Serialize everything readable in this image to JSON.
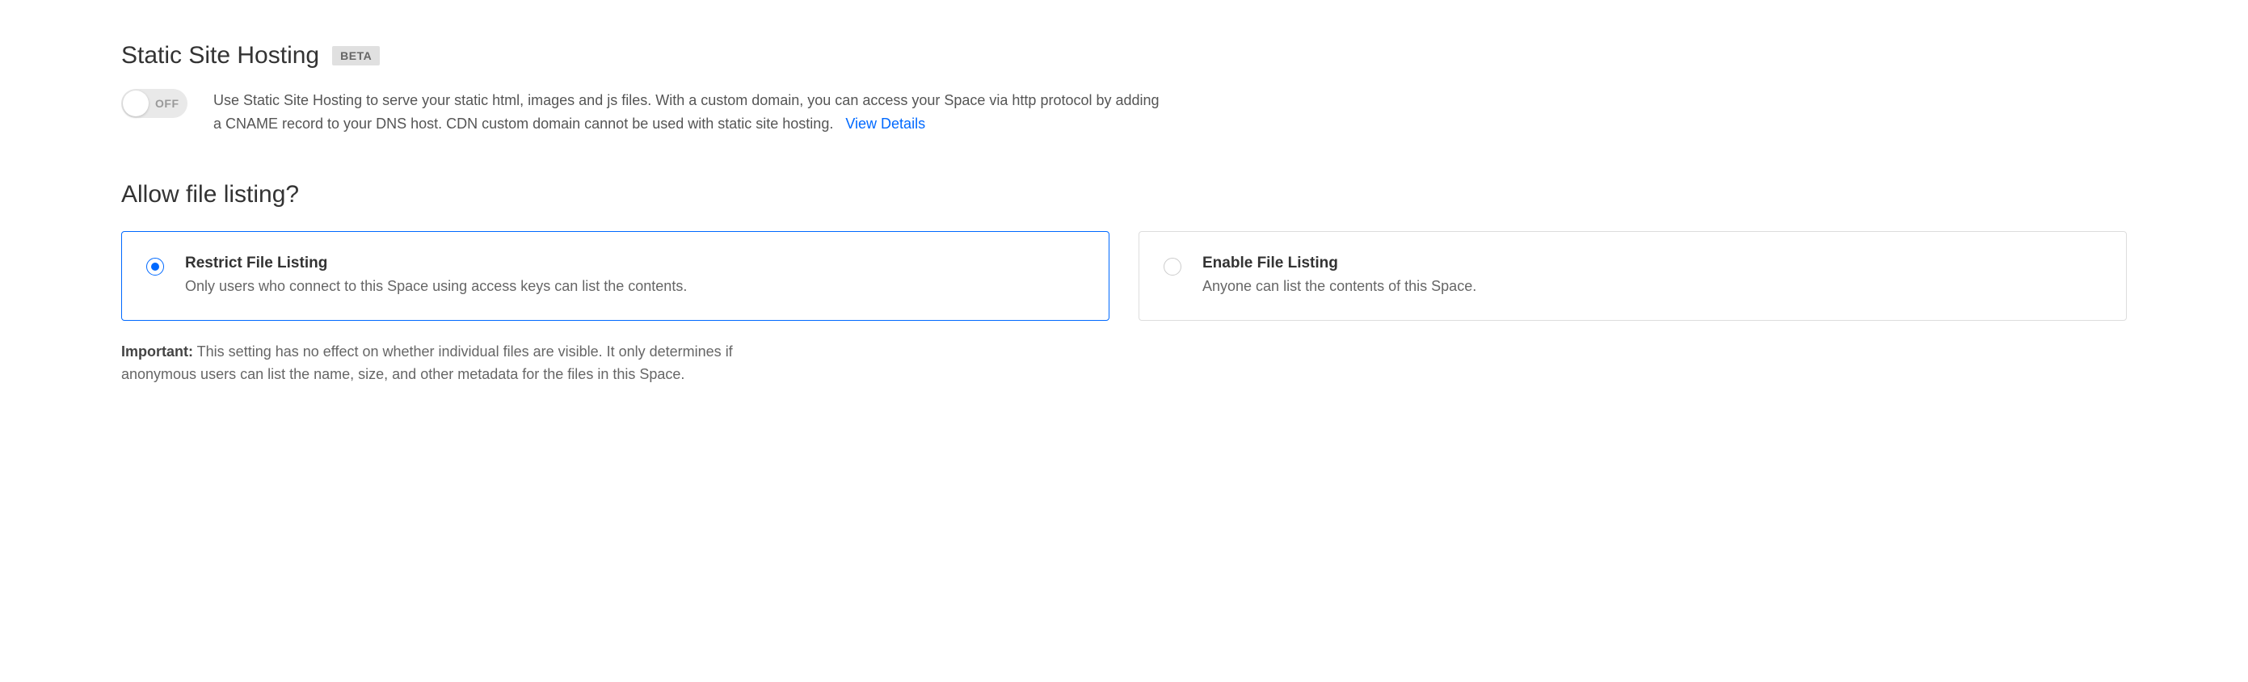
{
  "static_hosting": {
    "heading": "Static Site Hosting",
    "badge": "BETA",
    "toggle_state": "OFF",
    "description": "Use Static Site Hosting to serve your static html, images and js files. With a custom domain, you can access your Space via http protocol by adding a CNAME record to your DNS host. CDN custom domain cannot be used with static site hosting.",
    "link_text": "View Details"
  },
  "file_listing": {
    "heading": "Allow file listing?",
    "options": [
      {
        "title": "Restrict File Listing",
        "desc": "Only users who connect to this Space using access keys can list the contents."
      },
      {
        "title": "Enable File Listing",
        "desc": "Anyone can list the contents of this Space."
      }
    ],
    "important_label": "Important:",
    "important_text": " This setting has no effect on whether individual files are visible. It only determines if anonymous users can list the name, size, and other metadata for the files in this Space."
  }
}
